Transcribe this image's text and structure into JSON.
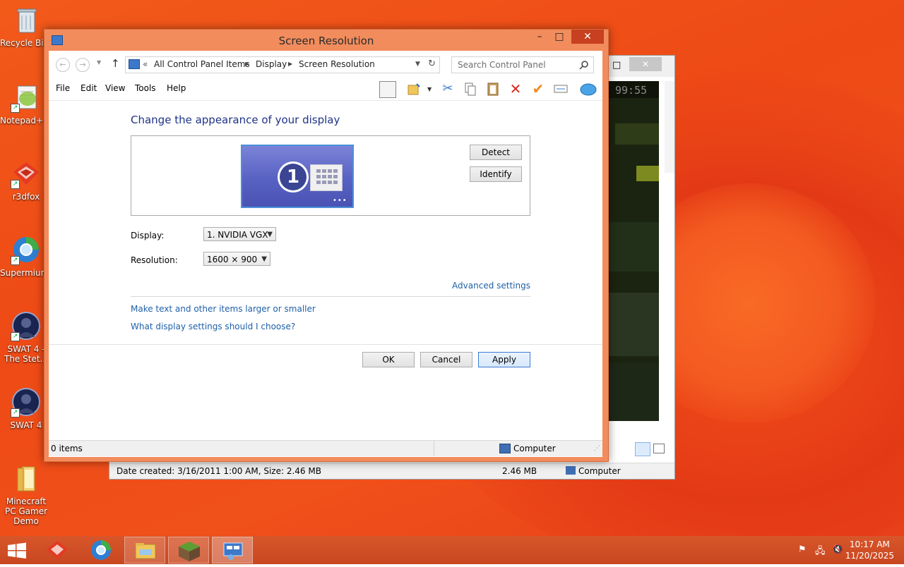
{
  "desktop": {
    "icons": [
      {
        "label": "Recycle Bin",
        "icon": "recycle-bin-icon"
      },
      {
        "label": "Notepad++",
        "icon": "notepad-plus-plus-icon"
      },
      {
        "label": "r3dfox",
        "icon": "r3dfox-icon"
      },
      {
        "label": "Supermium",
        "icon": "supermium-icon"
      },
      {
        "label": "SWAT 4 - The Stet...",
        "icon": "swat4-stetchkov-icon"
      },
      {
        "label": "SWAT 4",
        "icon": "swat4-icon"
      },
      {
        "label": "Minecraft PC Gamer Demo",
        "icon": "folder-icon"
      }
    ]
  },
  "back_window": {
    "timer": "99:55",
    "status_text": "Date created: 3/16/2011 1:00 AM, Size: 2.46 MB",
    "status_size": "2.46 MB",
    "status_location": "Computer"
  },
  "window": {
    "title": "Screen Resolution",
    "controls": {
      "minimize": "–",
      "maximize": "□",
      "close": "✕"
    },
    "breadcrumb": {
      "overflow": "«",
      "items": [
        "All Control Panel Items",
        "Display",
        "Screen Resolution"
      ]
    },
    "search_placeholder": "Search Control Panel",
    "menu": [
      "File",
      "Edit",
      "View",
      "Tools",
      "Help"
    ],
    "heading": "Change the appearance of your display",
    "monitor_number": "1",
    "buttons": {
      "detect": "Detect",
      "identify": "Identify",
      "ok": "OK",
      "cancel": "Cancel",
      "apply": "Apply"
    },
    "display_label": "Display:",
    "display_value": "1. NVIDIA VGX",
    "resolution_label": "Resolution:",
    "resolution_value": "1600 × 900",
    "advanced_link": "Advanced settings",
    "link_text_size": "Make text and other items larger or smaller",
    "link_help": "What display settings should I choose?",
    "status_items": "0 items",
    "status_location": "Computer"
  },
  "taskbar": {
    "apps": [
      "start-button",
      "r3dfox",
      "supermium",
      "file-explorer",
      "minecraft",
      "screen-resolution"
    ],
    "tray_icons": [
      "flag-icon",
      "network-icon",
      "volume-muted-icon"
    ],
    "time": "10:17 AM",
    "date": "11/20/2025"
  },
  "colors": {
    "accent": "#1e3287",
    "link": "#1e5fa8",
    "title_bar": "#f28c5c",
    "close": "#c7401f",
    "taskbar": "#cf4c23"
  }
}
